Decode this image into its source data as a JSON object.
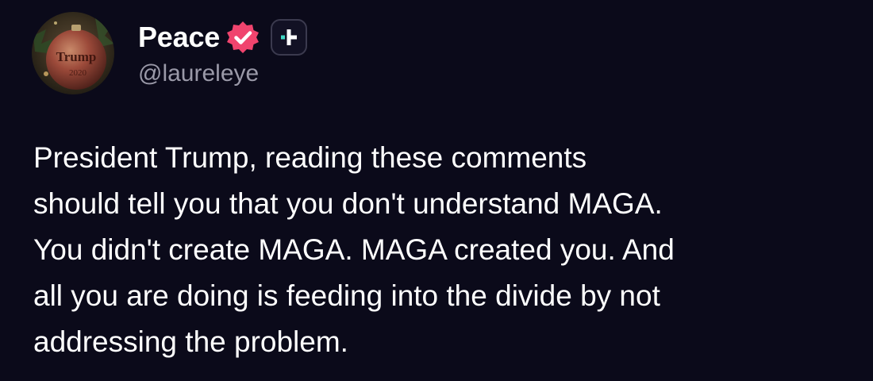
{
  "post": {
    "author": {
      "display_name": "Peace",
      "handle": "@laureleye",
      "avatar_icon": "trump-ornament-avatar",
      "verified_icon": "verified-badge-icon",
      "subscription_icon": "subscription-plus-icon"
    },
    "text": "President Trump, reading these comments\nshould tell you that you don't understand MAGA.\nYou didn't create MAGA. MAGA created you. And\nall you are doing is feeding into the divide by not\naddressing the problem."
  },
  "colors": {
    "background": "#0b0a1a",
    "text_primary": "#ffffff",
    "text_secondary": "#9a99a8",
    "verified_badge": "#f0446e",
    "subscription_accent": "#3fd7c4"
  }
}
